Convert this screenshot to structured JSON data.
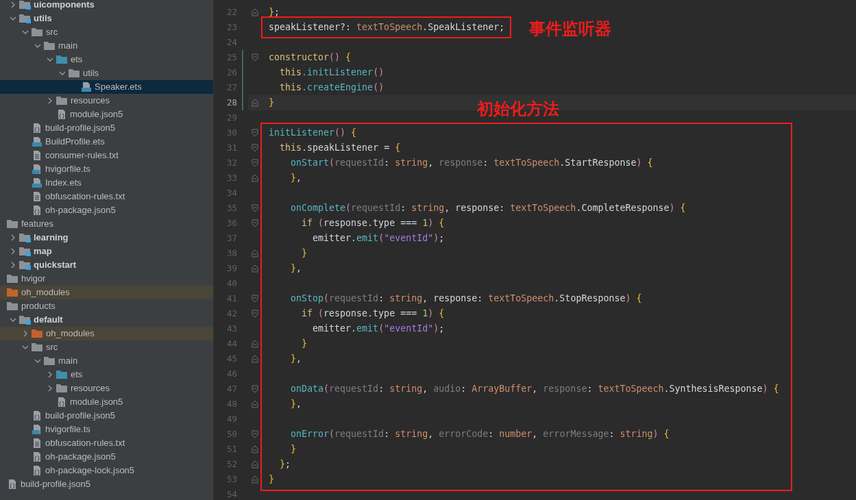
{
  "project_tree": [
    {
      "children": [
        {
          "name": "uicomponents",
          "kind": "module",
          "expanded": false,
          "selected": false
        },
        {
          "name": "utils",
          "kind": "module",
          "expanded": true,
          "selected": false,
          "children": [
            {
              "name": "src",
              "kind": "folder",
              "expanded": true,
              "selected": false,
              "children": [
                {
                  "name": "main",
                  "kind": "folder",
                  "expanded": true,
                  "selected": false,
                  "children": [
                    {
                      "name": "ets",
                      "kind": "source",
                      "expanded": true,
                      "selected": false,
                      "children": [
                        {
                          "name": "utils",
                          "kind": "folder",
                          "expanded": true,
                          "selected": false,
                          "children": [
                            {
                              "name": "Speaker.ets",
                              "kind": "ets",
                              "selected": true
                            }
                          ]
                        }
                      ]
                    },
                    {
                      "name": "resources",
                      "kind": "folder",
                      "expanded": false,
                      "selected": false
                    },
                    {
                      "name": "module.json5",
                      "kind": "json",
                      "selected": false
                    }
                  ]
                }
              ]
            },
            {
              "name": "build-profile.json5",
              "kind": "json",
              "selected": false
            },
            {
              "name": "BuildProfile.ets",
              "kind": "ets",
              "selected": false
            },
            {
              "name": "consumer-rules.txt",
              "kind": "txt",
              "selected": false
            },
            {
              "name": "hvigorfile.ts",
              "kind": "ts",
              "selected": false
            },
            {
              "name": "Index.ets",
              "kind": "ets",
              "selected": false
            },
            {
              "name": "obfuscation-rules.txt",
              "kind": "txt",
              "selected": false
            },
            {
              "name": "oh-package.json5",
              "kind": "json",
              "selected": false
            }
          ]
        }
      ]
    },
    {
      "name": "features",
      "kind": "folder",
      "selected": false,
      "children": [
        {
          "name": "learning",
          "kind": "module",
          "expanded": false,
          "selected": false
        },
        {
          "name": "map",
          "kind": "module",
          "expanded": false,
          "selected": false
        },
        {
          "name": "quickstart",
          "kind": "module",
          "expanded": false,
          "selected": false
        }
      ]
    },
    {
      "name": "hvigor",
      "kind": "folder",
      "selected": false
    },
    {
      "name": "oh_modules",
      "kind": "excluded",
      "selected": false
    },
    {
      "name": "products",
      "kind": "folder",
      "selected": false,
      "children": [
        {
          "name": "default",
          "kind": "module",
          "expanded": true,
          "selected": false,
          "children": [
            {
              "name": "oh_modules",
              "kind": "excluded",
              "expanded": false,
              "selected": false
            },
            {
              "name": "src",
              "kind": "folder",
              "expanded": true,
              "selected": false,
              "children": [
                {
                  "name": "main",
                  "kind": "folder",
                  "expanded": true,
                  "selected": false,
                  "children": [
                    {
                      "name": "ets",
                      "kind": "source",
                      "expanded": false,
                      "selected": false
                    },
                    {
                      "name": "resources",
                      "kind": "folder",
                      "expanded": false,
                      "selected": false
                    },
                    {
                      "name": "module.json5",
                      "kind": "json",
                      "selected": false
                    }
                  ]
                }
              ]
            },
            {
              "name": "build-profile.json5",
              "kind": "json",
              "selected": false
            },
            {
              "name": "hvigorfile.ts",
              "kind": "ts",
              "selected": false
            },
            {
              "name": "obfuscation-rules.txt",
              "kind": "txt",
              "selected": false
            },
            {
              "name": "oh-package.json5",
              "kind": "json",
              "selected": false
            },
            {
              "name": "oh-package-lock.json5",
              "kind": "json",
              "selected": false
            }
          ]
        }
      ]
    },
    {
      "name": "build-profile.json5",
      "kind": "json",
      "selected": false
    }
  ],
  "editor": {
    "lines": [
      {
        "number": "22",
        "fold": {
          "kind": "end"
        },
        "tokens": [
          {
            "kind": "brace",
            "t": "}"
          },
          {
            "kind": "text",
            "t": ";"
          }
        ]
      },
      {
        "number": "23",
        "framed": true,
        "tokens": [
          {
            "kind": "text",
            "t": "speakListener?: "
          },
          {
            "kind": "type",
            "t": "textToSpeech"
          },
          {
            "kind": "text",
            "t": ".SpeakListener;"
          }
        ]
      },
      {
        "number": "24"
      },
      {
        "number": "25",
        "fold": {
          "kind": "start"
        },
        "changed": true,
        "tokens": [
          {
            "kind": "kw",
            "t": "constructor"
          },
          {
            "kind": "paren",
            "t": "()"
          },
          {
            "kind": "brace",
            "t": " {"
          }
        ]
      },
      {
        "number": "26",
        "changed": true,
        "tokens": [
          {
            "kind": "kw",
            "t": "  this"
          },
          {
            "kind": "fn",
            "t": ".initListener"
          },
          {
            "kind": "paren",
            "t": "()"
          }
        ]
      },
      {
        "number": "27",
        "changed": true,
        "tokens": [
          {
            "kind": "kw",
            "t": "  this"
          },
          {
            "kind": "fn",
            "t": ".createEngine"
          },
          {
            "kind": "paren",
            "t": "()"
          }
        ]
      },
      {
        "number": "28",
        "fold": {
          "kind": "end"
        },
        "changed": true,
        "current": true,
        "tokens": [
          {
            "kind": "brace",
            "t": "}"
          }
        ]
      },
      {
        "number": "29"
      },
      {
        "number": "30",
        "fold": {
          "kind": "start"
        },
        "tokens": [
          {
            "kind": "fn",
            "t": "initListener"
          },
          {
            "kind": "paren",
            "t": "()"
          },
          {
            "kind": "brace",
            "t": " {"
          }
        ]
      },
      {
        "number": "31",
        "fold": {
          "kind": "start"
        },
        "tokens": [
          {
            "kind": "kw",
            "t": "  this"
          },
          {
            "kind": "text",
            "t": ".speakListener = "
          },
          {
            "kind": "brace",
            "t": "{"
          }
        ]
      },
      {
        "number": "32",
        "fold": {
          "kind": "start"
        },
        "tokens": [
          {
            "kind": "fn",
            "t": "    onStart"
          },
          {
            "kind": "paren",
            "t": "("
          },
          {
            "kind": "param",
            "t": "requestId"
          },
          {
            "kind": "text",
            "t": ": "
          },
          {
            "kind": "type",
            "t": "string"
          },
          {
            "kind": "text",
            "t": ", "
          },
          {
            "kind": "param",
            "t": "response"
          },
          {
            "kind": "text",
            "t": ": "
          },
          {
            "kind": "type",
            "t": "textToSpeech"
          },
          {
            "kind": "text",
            "t": ".StartResponse"
          },
          {
            "kind": "paren",
            "t": ")"
          },
          {
            "kind": "brace",
            "t": " {"
          }
        ]
      },
      {
        "number": "33",
        "fold": {
          "kind": "end"
        },
        "tokens": [
          {
            "kind": "brace",
            "t": "    }"
          },
          {
            "kind": "text",
            "t": ","
          }
        ]
      },
      {
        "number": "34"
      },
      {
        "number": "35",
        "fold": {
          "kind": "start"
        },
        "tokens": [
          {
            "kind": "fn",
            "t": "    onComplete"
          },
          {
            "kind": "paren",
            "t": "("
          },
          {
            "kind": "param",
            "t": "requestId"
          },
          {
            "kind": "text",
            "t": ": "
          },
          {
            "kind": "type",
            "t": "string"
          },
          {
            "kind": "text",
            "t": ", response: "
          },
          {
            "kind": "type",
            "t": "textToSpeech"
          },
          {
            "kind": "text",
            "t": ".CompleteResponse"
          },
          {
            "kind": "paren",
            "t": ")"
          },
          {
            "kind": "brace",
            "t": " {"
          }
        ]
      },
      {
        "number": "36",
        "fold": {
          "kind": "start"
        },
        "tokens": [
          {
            "kind": "kw",
            "t": "      if"
          },
          {
            "kind": "paren",
            "t": " ("
          },
          {
            "kind": "text",
            "t": "response.type === "
          },
          {
            "kind": "num",
            "t": "1"
          },
          {
            "kind": "paren",
            "t": ")"
          },
          {
            "kind": "brace",
            "t": " {"
          }
        ]
      },
      {
        "number": "37",
        "tokens": [
          {
            "kind": "text",
            "t": "        emitter."
          },
          {
            "kind": "fn",
            "t": "emit"
          },
          {
            "kind": "paren",
            "t": "("
          },
          {
            "kind": "str",
            "t": "\"eventId\""
          },
          {
            "kind": "paren",
            "t": ")"
          },
          {
            "kind": "text",
            "t": ";"
          }
        ]
      },
      {
        "number": "38",
        "fold": {
          "kind": "end"
        },
        "tokens": [
          {
            "kind": "brace",
            "t": "      }"
          }
        ]
      },
      {
        "number": "39",
        "fold": {
          "kind": "end"
        },
        "tokens": [
          {
            "kind": "brace",
            "t": "    }"
          },
          {
            "kind": "text",
            "t": ","
          }
        ]
      },
      {
        "number": "40"
      },
      {
        "number": "41",
        "fold": {
          "kind": "start"
        },
        "tokens": [
          {
            "kind": "fn",
            "t": "    onStop"
          },
          {
            "kind": "paren",
            "t": "("
          },
          {
            "kind": "param",
            "t": "requestId"
          },
          {
            "kind": "text",
            "t": ": "
          },
          {
            "kind": "type",
            "t": "string"
          },
          {
            "kind": "text",
            "t": ", response: "
          },
          {
            "kind": "type",
            "t": "textToSpeech"
          },
          {
            "kind": "text",
            "t": ".StopResponse"
          },
          {
            "kind": "paren",
            "t": ")"
          },
          {
            "kind": "brace",
            "t": " {"
          }
        ]
      },
      {
        "number": "42",
        "fold": {
          "kind": "start"
        },
        "tokens": [
          {
            "kind": "kw",
            "t": "      if"
          },
          {
            "kind": "paren",
            "t": " ("
          },
          {
            "kind": "text",
            "t": "response.type === "
          },
          {
            "kind": "num",
            "t": "1"
          },
          {
            "kind": "paren",
            "t": ")"
          },
          {
            "kind": "brace",
            "t": " {"
          }
        ]
      },
      {
        "number": "43",
        "tokens": [
          {
            "kind": "text",
            "t": "        emitter."
          },
          {
            "kind": "fn",
            "t": "emit"
          },
          {
            "kind": "paren",
            "t": "("
          },
          {
            "kind": "str",
            "t": "\"eventId\""
          },
          {
            "kind": "paren",
            "t": ")"
          },
          {
            "kind": "text",
            "t": ";"
          }
        ]
      },
      {
        "number": "44",
        "fold": {
          "kind": "end"
        },
        "tokens": [
          {
            "kind": "brace",
            "t": "      }"
          }
        ]
      },
      {
        "number": "45",
        "fold": {
          "kind": "end"
        },
        "tokens": [
          {
            "kind": "brace",
            "t": "    }"
          },
          {
            "kind": "text",
            "t": ","
          }
        ]
      },
      {
        "number": "46"
      },
      {
        "number": "47",
        "fold": {
          "kind": "start"
        },
        "tokens": [
          {
            "kind": "fn",
            "t": "    onData"
          },
          {
            "kind": "paren",
            "t": "("
          },
          {
            "kind": "param",
            "t": "requestId"
          },
          {
            "kind": "text",
            "t": ": "
          },
          {
            "kind": "type",
            "t": "string"
          },
          {
            "kind": "text",
            "t": ", "
          },
          {
            "kind": "param",
            "t": "audio"
          },
          {
            "kind": "text",
            "t": ": "
          },
          {
            "kind": "type",
            "t": "ArrayBuffer"
          },
          {
            "kind": "text",
            "t": ", "
          },
          {
            "kind": "param",
            "t": "response"
          },
          {
            "kind": "text",
            "t": ": "
          },
          {
            "kind": "type",
            "t": "textToSpeech"
          },
          {
            "kind": "text",
            "t": ".SynthesisResponse"
          },
          {
            "kind": "paren",
            "t": ")"
          },
          {
            "kind": "brace",
            "t": " {"
          }
        ]
      },
      {
        "number": "48",
        "fold": {
          "kind": "end"
        },
        "tokens": [
          {
            "kind": "brace",
            "t": "    }"
          },
          {
            "kind": "text",
            "t": ","
          }
        ]
      },
      {
        "number": "49"
      },
      {
        "number": "50",
        "fold": {
          "kind": "start"
        },
        "tokens": [
          {
            "kind": "fn",
            "t": "    onError"
          },
          {
            "kind": "paren",
            "t": "("
          },
          {
            "kind": "param",
            "t": "requestId"
          },
          {
            "kind": "text",
            "t": ": "
          },
          {
            "kind": "type",
            "t": "string"
          },
          {
            "kind": "text",
            "t": ", "
          },
          {
            "kind": "param",
            "t": "errorCode"
          },
          {
            "kind": "text",
            "t": ": "
          },
          {
            "kind": "type",
            "t": "number"
          },
          {
            "kind": "text",
            "t": ", "
          },
          {
            "kind": "param",
            "t": "errorMessage"
          },
          {
            "kind": "text",
            "t": ": "
          },
          {
            "kind": "type",
            "t": "string"
          },
          {
            "kind": "paren",
            "t": ")"
          },
          {
            "kind": "brace",
            "t": " {"
          }
        ]
      },
      {
        "number": "51",
        "fold": {
          "kind": "end"
        },
        "tokens": [
          {
            "kind": "brace",
            "t": "    }"
          }
        ]
      },
      {
        "number": "52",
        "fold": {
          "kind": "end"
        },
        "tokens": [
          {
            "kind": "brace",
            "t": "  }"
          },
          {
            "kind": "text",
            "t": ";"
          }
        ]
      },
      {
        "number": "53",
        "fold": {
          "kind": "end"
        },
        "tokens": [
          {
            "kind": "brace",
            "t": "}"
          }
        ]
      },
      {
        "number": "54"
      }
    ]
  },
  "callouts": [
    {
      "text": "事件监听器"
    },
    {
      "text": "初始化方法"
    }
  ]
}
